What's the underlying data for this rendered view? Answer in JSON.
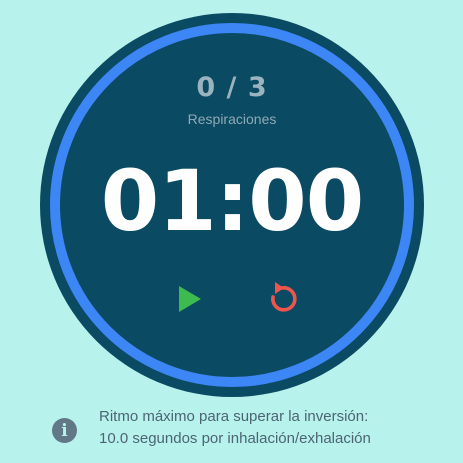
{
  "counter": {
    "value": "0 / 3",
    "label": "Respiraciones"
  },
  "timer": {
    "display": "01:00"
  },
  "controls": {
    "play_icon": "play-icon",
    "reset_icon": "reset-icon"
  },
  "info": {
    "icon": "info-icon",
    "line1": "Ritmo máximo para superar la inversión:",
    "line2": "10.0 segundos por inhalación/exhalación"
  },
  "colors": {
    "background": "#b7f2ec",
    "dial": "#0b4a63",
    "ring": "#3d86f5",
    "play": "#3dbb4f",
    "reset": "#f0554d"
  }
}
